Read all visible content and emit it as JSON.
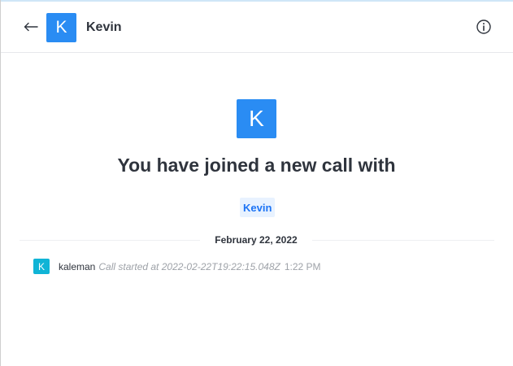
{
  "header": {
    "back_icon": "arrow-left-icon",
    "avatar_letter": "K",
    "title": "Kevin",
    "info_icon": "info-icon"
  },
  "intro": {
    "avatar_letter": "K",
    "heading": "You have joined a new call with",
    "mention": "Kevin"
  },
  "divider": {
    "date": "February 22, 2022"
  },
  "message": {
    "avatar_letter": "K",
    "username": "kaleman",
    "text": "Call started at 2022-02-22T19:22:15.048Z",
    "time": "1:22 PM"
  },
  "colors": {
    "avatar_blue": "#2a8cf3",
    "avatar_teal": "#10b4d6",
    "mention_bg": "#e8f2ff",
    "mention_text": "#1d74f5"
  }
}
